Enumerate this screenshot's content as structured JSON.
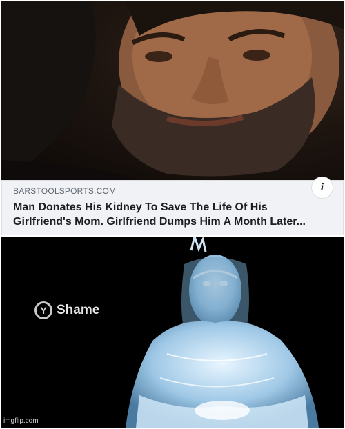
{
  "post": {
    "photo_alt": "man-selfie-photo",
    "link_preview": {
      "source": "BARSTOOLSPORTS.COM",
      "headline": "Man Donates His Kidney To Save The Life Of His Girlfriend's Mom. Girlfriend Dumps Him A Month Later...",
      "info_glyph": "i"
    }
  },
  "game_prompt": {
    "button_glyph": "Y",
    "action_label": "Shame"
  },
  "watermark": "imgflip.com"
}
